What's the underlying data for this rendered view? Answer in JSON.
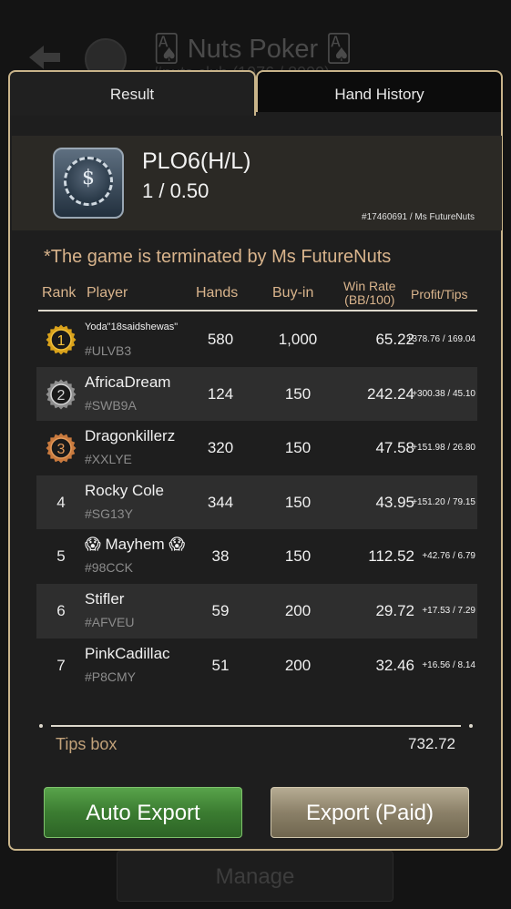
{
  "background": {
    "title": "🂡 Nuts Poker 🂡",
    "subtitle": "#nuts club (1076 / 8999)",
    "manage_label": "Manage"
  },
  "tabs": {
    "result": "Result",
    "hand_history": "Hand History"
  },
  "game": {
    "name": "PLO6(H/L)",
    "blinds": "1 / 0.50",
    "id_line": "#17460691 / Ms FutureNuts",
    "chip_symbol": "$"
  },
  "notice": "*The game is terminated by Ms FutureNuts",
  "columns": {
    "rank": "Rank",
    "player": "Player",
    "hands": "Hands",
    "buyin": "Buy-in",
    "winrate_1": "Win Rate",
    "winrate_2": "(BB/100)",
    "profit": "Profit/Tips"
  },
  "rows": [
    {
      "rank": "1",
      "medal": "gold",
      "player": "Yoda\"18saidshewas\"",
      "id": "#ULVB3",
      "hands": "580",
      "buyin": "1,000",
      "winrate": "65.22",
      "profit": "+378.76 / 169.04"
    },
    {
      "rank": "2",
      "medal": "silver",
      "player": "AfricaDream",
      "id": "#SWB9A",
      "hands": "124",
      "buyin": "150",
      "winrate": "242.24",
      "profit": "+300.38 / 45.10"
    },
    {
      "rank": "3",
      "medal": "bronze",
      "player": "Dragonkillerz",
      "id": "#XXLYE",
      "hands": "320",
      "buyin": "150",
      "winrate": "47.58",
      "profit": "+151.98 / 26.80"
    },
    {
      "rank": "4",
      "medal": "",
      "player": "Rocky Cole",
      "id": "#SG13Y",
      "hands": "344",
      "buyin": "150",
      "winrate": "43.95",
      "profit": "+151.20 / 79.15"
    },
    {
      "rank": "5",
      "medal": "",
      "player": "😱 Mayhem 😱",
      "id": "#98CCK",
      "hands": "38",
      "buyin": "150",
      "winrate": "112.52",
      "profit": "+42.76 / 6.79"
    },
    {
      "rank": "6",
      "medal": "",
      "player": "Stifler",
      "id": "#AFVEU",
      "hands": "59",
      "buyin": "200",
      "winrate": "29.72",
      "profit": "+17.53 / 7.29"
    },
    {
      "rank": "7",
      "medal": "",
      "player": "PinkCadillac",
      "id": "#P8CMY",
      "hands": "51",
      "buyin": "200",
      "winrate": "32.46",
      "profit": "+16.56 / 8.14"
    }
  ],
  "tips": {
    "label": "Tips box",
    "value": "732.72"
  },
  "buttons": {
    "auto_export": "Auto Export",
    "export_paid": "Export (Paid)"
  },
  "colors": {
    "accent_gold": "#c9b48a",
    "header_text": "#d9b48c",
    "auto_export_green": "#3b7c31",
    "export_paid_tan": "#8b8068"
  }
}
